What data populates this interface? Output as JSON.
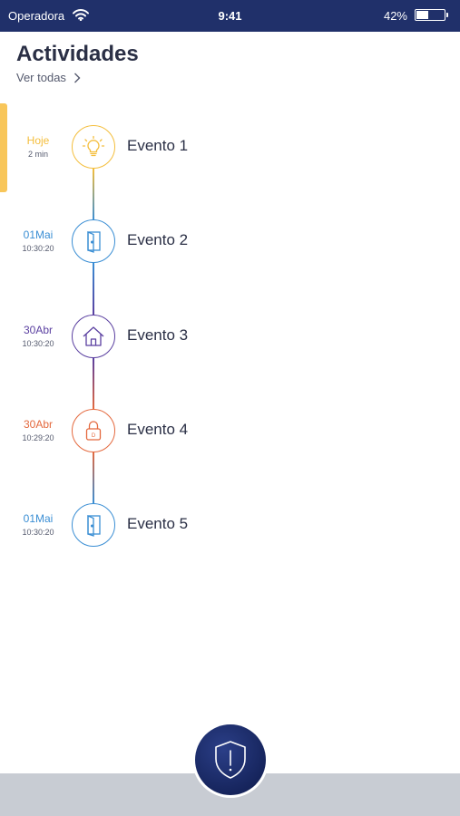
{
  "status_bar": {
    "carrier": "Operadora",
    "time": "9:41",
    "battery_percent": "42%",
    "battery_level": 0.42
  },
  "header": {
    "title": "Actividades",
    "see_all": "Ver todas"
  },
  "timeline": [
    {
      "date": "Hoje",
      "time": "2 min",
      "label": "Evento 1",
      "icon": "lightbulb-icon",
      "color": "#f4be3c",
      "active": true
    },
    {
      "date": "01Mai",
      "time": "10:30:20",
      "label": "Evento 2",
      "icon": "door-icon",
      "color": "#3a8ed4"
    },
    {
      "date": "30Abr",
      "time": "10:30:20",
      "label": "Evento 3",
      "icon": "house-icon",
      "color": "#5a3fa0"
    },
    {
      "date": "30Abr",
      "time": "10:29:20",
      "label": "Evento 4",
      "icon": "padlock-icon",
      "color": "#e4693e"
    },
    {
      "date": "01Mai",
      "time": "10:30:20",
      "label": "Evento 5",
      "icon": "door-icon",
      "color": "#3a8ed4"
    }
  ],
  "fab": {
    "icon": "shield-alert-icon"
  },
  "colors": {
    "status_bar": "#20306a",
    "accent": "#f8c65a",
    "fab": "#1b2a6b",
    "bottom_bar": "#c8ccd3"
  }
}
